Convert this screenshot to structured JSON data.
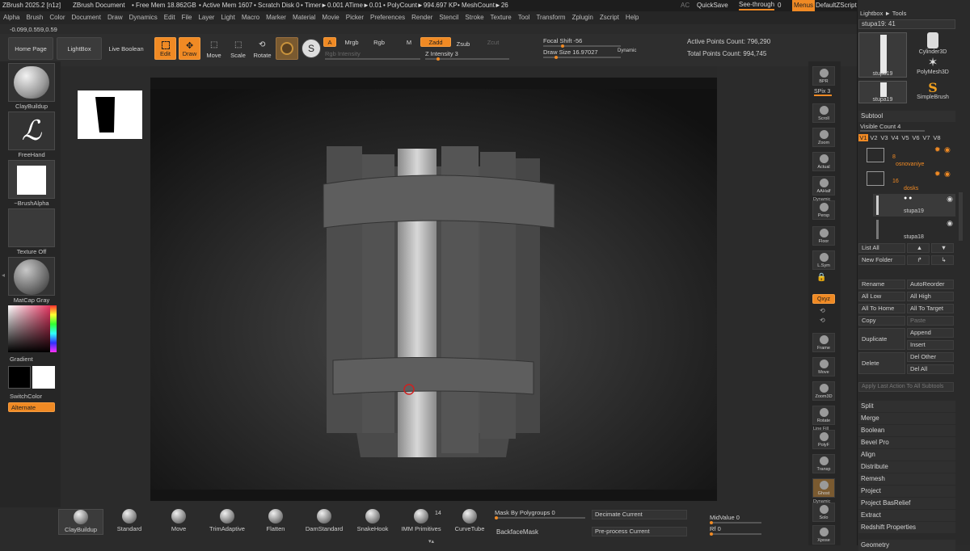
{
  "titlebar": {
    "app": "ZBrush 2025.2 [n1z]",
    "document": "ZBrush Document",
    "free_mem": "• Free Mem 18.862GB",
    "active_mem": "• Active Mem 1607",
    "scratch": "• Scratch Disk 0",
    "timer": "• Timer►0.001 ATime►0.01",
    "polycount": "• PolyCount►994.697 KP",
    "meshcount": "• MeshCount►26",
    "ac": "AC",
    "quicksave": "QuickSave",
    "seethrough": "See-through",
    "seethrough_val": "0",
    "menus": "Menus",
    "script": "DefaultZScript"
  },
  "menubar": [
    "Alpha",
    "Brush",
    "Color",
    "Document",
    "Draw",
    "Dynamics",
    "Edit",
    "File",
    "Layer",
    "Light",
    "Macro",
    "Marker",
    "Material",
    "Movie",
    "Picker",
    "Preferences",
    "Render",
    "Stencil",
    "Stroke",
    "Texture",
    "Tool",
    "Transform",
    "Zplugin",
    "Zscript",
    "Help"
  ],
  "coords": "-0.099,0.559,0.59",
  "shelf": {
    "home": "Home Page",
    "lightbox": "LightBox",
    "liveboolean": "Live Boolean",
    "edit": "Edit",
    "draw": "Draw",
    "move": "Move",
    "scale": "Scale",
    "rotate": "Rotate",
    "a": "A",
    "mrgb": "Mrgb",
    "rgb": "Rgb",
    "m": "M",
    "zadd": "Zadd",
    "zsub": "Zsub",
    "zcut": "Zcut",
    "rgb_intensity": "Rgb Intensity",
    "z_intensity": "Z Intensity 3",
    "focal_shift": "Focal Shift -56",
    "draw_size": "Draw Size 16.97027",
    "dynamic": "Dynamic",
    "active_points": "Active Points Count: 796,290",
    "total_points": "Total Points Count: 994,745"
  },
  "left": {
    "brush": "ClayBuildup",
    "stroke": "FreeHand",
    "alpha": "~BrushAlpha",
    "texture": "Texture Off",
    "material": "MatCap Gray",
    "gradient": "Gradient",
    "switchcolor": "SwitchColor",
    "alternate": "Alternate"
  },
  "rightshelf": [
    "BPR",
    "SPix 3",
    "Scroll",
    "Zoom",
    "Actual",
    "AAHalf",
    "Persp",
    "Floor",
    "L.Sym",
    "",
    "Qxyz",
    "",
    "",
    "Frame",
    "Move",
    "Zoom3D",
    "Rotate",
    "PolyF",
    "Transp",
    "Ghost",
    "Solo",
    "Xpose"
  ],
  "rightshelf_labels": {
    "dynamic": "Dynamic",
    "linefill": "Line Fill",
    "dynamic2": "Dynamic"
  },
  "tool": {
    "header": "Lightbox ► Tools",
    "current": "stupa19: 41",
    "thumbs": [
      "stupa19",
      "Cylinder3D",
      "PolyMesh3D",
      "stupa19",
      "SimpleBrush"
    ]
  },
  "subtool": {
    "title": "Subtool",
    "visible": "Visible Count 4",
    "versions": [
      "V1",
      "V2",
      "V3",
      "V4",
      "V5",
      "V6",
      "V7",
      "V8"
    ],
    "folders": [
      {
        "count": "8",
        "name": "osnovaniye"
      },
      {
        "count": "16",
        "name": "dosks"
      }
    ],
    "items": [
      "stupa19",
      "stupa18"
    ],
    "list_all": "List All",
    "new_folder": "New Folder",
    "rename": "Rename",
    "autoreorder": "AutoReorder",
    "all_low": "All Low",
    "all_high": "All High",
    "all_to_home": "All To Home",
    "all_to_target": "All To Target",
    "copy": "Copy",
    "paste": "Paste",
    "duplicate": "Duplicate",
    "append": "Append",
    "insert": "Insert",
    "delete": "Delete",
    "del_other": "Del Other",
    "del_all": "Del All",
    "apply_last": "Apply Last Action To All Subtools",
    "actions": [
      "Split",
      "Merge",
      "Boolean",
      "Bevel Pro",
      "Align",
      "Distribute",
      "Remesh",
      "Project",
      "Project BasRelief",
      "Extract",
      "Redshift Properties"
    ],
    "geometry": "Geometry"
  },
  "bottom": {
    "brushes": [
      "ClayBuildup",
      "Standard",
      "Move",
      "TrimAdaptive",
      "Flatten",
      "DamStandard",
      "SnakeHook",
      "IMM Primitives",
      "CurveTube"
    ],
    "imm_count": "14",
    "mask_by_polygroups": "Mask By Polygroups 0",
    "backfacemask": "BackfaceMask",
    "decimate": "Decimate Current",
    "preprocess": "Pre-process Current",
    "midvalue": "MidValue 0",
    "rf": "Rf 0"
  },
  "colors": {
    "accent": "#f08a24",
    "bg": "#2b2b2b",
    "viewport": "#141414"
  }
}
